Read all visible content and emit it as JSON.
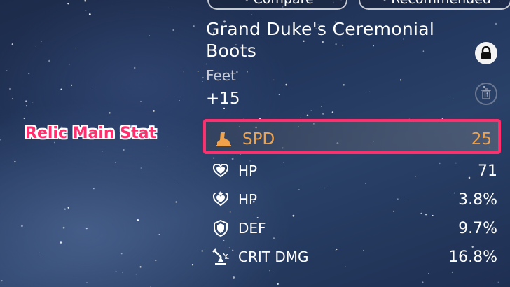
{
  "buttons": {
    "compare": "Compare",
    "recommended": "Recommended"
  },
  "relic": {
    "name": "Grand Duke's Ceremonial Boots",
    "slot": "Feet",
    "level": "+15"
  },
  "main_stat": {
    "name": "SPD",
    "value": "25",
    "icon": "boot-icon"
  },
  "sub_stats": [
    {
      "name": "HP",
      "value": "71",
      "icon": "heart-icon"
    },
    {
      "name": "HP",
      "value": "3.8%",
      "icon": "heart-icon"
    },
    {
      "name": "DEF",
      "value": "9.7%",
      "icon": "shield-icon"
    },
    {
      "name": "CRIT DMG",
      "value": "16.8%",
      "icon": "crit-dmg-icon"
    }
  ],
  "annotation": "Relic Main Stat",
  "colors": {
    "accent": "#f0a24a",
    "highlight": "#ff2f6d"
  }
}
